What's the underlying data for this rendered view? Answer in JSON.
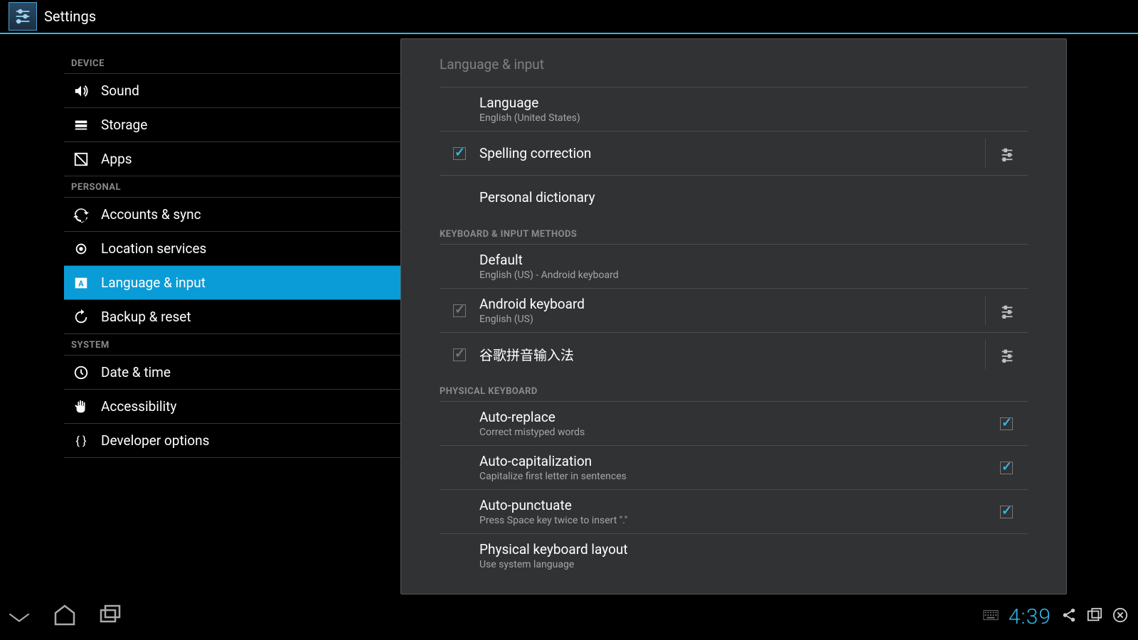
{
  "header": {
    "title": "Settings"
  },
  "sidebar": {
    "sections": [
      {
        "header": "DEVICE",
        "items": [
          {
            "id": "sound",
            "label": "Sound"
          },
          {
            "id": "storage",
            "label": "Storage"
          },
          {
            "id": "apps",
            "label": "Apps"
          }
        ]
      },
      {
        "header": "PERSONAL",
        "items": [
          {
            "id": "accounts",
            "label": "Accounts & sync"
          },
          {
            "id": "location",
            "label": "Location services"
          },
          {
            "id": "language",
            "label": "Language & input",
            "selected": true
          },
          {
            "id": "backup",
            "label": "Backup & reset"
          }
        ]
      },
      {
        "header": "SYSTEM",
        "items": [
          {
            "id": "datetime",
            "label": "Date & time"
          },
          {
            "id": "accessibility",
            "label": "Accessibility"
          },
          {
            "id": "developer",
            "label": "Developer options"
          }
        ]
      }
    ]
  },
  "detail": {
    "title": "Language & input",
    "rows1": {
      "language": {
        "title": "Language",
        "sub": "English (United States)"
      },
      "spelling": {
        "title": "Spelling correction"
      },
      "dictionary": {
        "title": "Personal dictionary"
      }
    },
    "section_keyboard": "KEYBOARD & INPUT METHODS",
    "rows2": {
      "default": {
        "title": "Default",
        "sub": "English (US) - Android keyboard"
      },
      "android_kb": {
        "title": "Android keyboard",
        "sub": "English (US)"
      },
      "pinyin": {
        "title": "谷歌拼音输入法"
      }
    },
    "section_physical": "PHYSICAL KEYBOARD",
    "rows3": {
      "auto_replace": {
        "title": "Auto-replace",
        "sub": "Correct mistyped words"
      },
      "auto_cap": {
        "title": "Auto-capitalization",
        "sub": "Capitalize first letter in sentences"
      },
      "auto_punct": {
        "title": "Auto-punctuate",
        "sub": "Press Space key twice to insert \".\""
      },
      "phys_layout": {
        "title": "Physical keyboard layout",
        "sub": "Use system language"
      }
    }
  },
  "statusbar": {
    "time": "4:39"
  }
}
